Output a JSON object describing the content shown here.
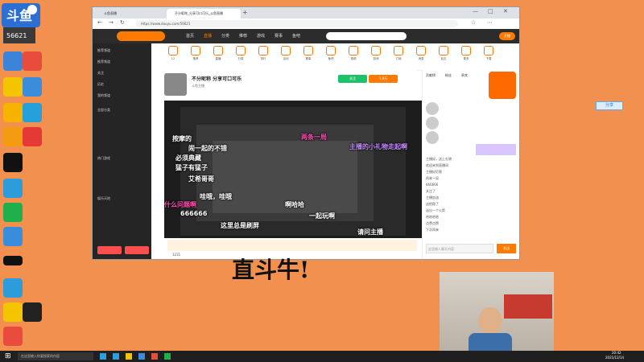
{
  "desktop": {
    "stream_logo_text": "斗鱼",
    "logo_subtext": "56621",
    "icons": [
      {
        "label": ""
      },
      {
        "label": ""
      },
      {
        "label": ""
      },
      {
        "label": ""
      },
      {
        "label": ""
      },
      {
        "label": ""
      },
      {
        "label": ""
      },
      {
        "label": ""
      },
      {
        "label": ""
      },
      {
        "label": ""
      },
      {
        "label": ""
      },
      {
        "label": ""
      }
    ],
    "overlay_text": "直斗牛!",
    "float_button": "分享"
  },
  "browser": {
    "tabs": [
      {
        "label": "斗鱼直播"
      },
      {
        "label": "不分昵称_分享可口可乐_斗鱼直播"
      }
    ],
    "url": "https://www.douyu.com/56621"
  },
  "douyu": {
    "nav": [
      "首页",
      "直播",
      "分类",
      "推荐",
      "游戏",
      "赛事",
      "鱼吧"
    ],
    "top_right": "开播",
    "sidebar_sections": [
      {
        "label": "推荐频道"
      },
      {
        "label": "推荐频道"
      },
      {
        "label": "关注"
      },
      {
        "label": "历史"
      },
      {
        "label": "我的频道"
      },
      {
        "label": "全部分类"
      },
      {
        "label": "热门游戏"
      },
      {
        "label": "娱乐天地"
      }
    ],
    "categories": [
      "12",
      "推荐",
      "直播",
      "分类",
      "排行",
      "活动",
      "赛事",
      "鱼吧",
      "视频",
      "游戏",
      "订阅",
      "消息",
      "钻石",
      "更多",
      "下载",
      "会员",
      "任务",
      "设置"
    ],
    "room_title": "不分昵称 分享可口可乐",
    "room_sub": "斗鱼主播",
    "room_tags": [
      "关注",
      "1.8万"
    ],
    "danmaku": [
      {
        "text": "按摩的",
        "color": "#ffffff"
      },
      {
        "text": "闹一起的不错",
        "color": "#ffffff"
      },
      {
        "text": "必须典藏",
        "color": "#ffffff"
      },
      {
        "text": "猛子有猛子",
        "color": "#ffffff"
      },
      {
        "text": "艾希哥哥",
        "color": "#ffffff"
      },
      {
        "text": "哇哦，哇哦",
        "color": "#ffffff"
      },
      {
        "text": "666666",
        "color": "#ffffff"
      },
      {
        "text": "啊哈哈",
        "color": "#ffffff"
      },
      {
        "text": "一起玩啊",
        "color": "#ffffff"
      },
      {
        "text": "两条一局",
        "color": "#ff4fb3"
      },
      {
        "text": "主播的小礼物走起啊",
        "color": "#8a2be2"
      },
      {
        "text": "什么问题啊",
        "color": "#ff4fb3"
      },
      {
        "text": "这里总是刷屏",
        "color": "#ffffff"
      },
      {
        "text": "请问主播",
        "color": "#ffffff"
      }
    ],
    "chat_tabs": [
      "贡献榜",
      "粉丝",
      "贵宾"
    ],
    "chat_lines": [
      "主播好，送上礼物",
      "欢迎来到直播间",
      "主播好厉害",
      "再来一局",
      "666666",
      "关注了",
      "主播加油",
      "这把稳了",
      "送出一个火箭",
      "哈哈哈哈",
      "点赞点赞",
      "下次再来"
    ],
    "chat_input_placeholder": "这里输入聊天内容",
    "send_label": "发送",
    "gift_count": "1231"
  },
  "taskbar": {
    "search_placeholder": "在这里输入你要搜索的内容",
    "time": "20:42",
    "date": "2021/12/14"
  }
}
